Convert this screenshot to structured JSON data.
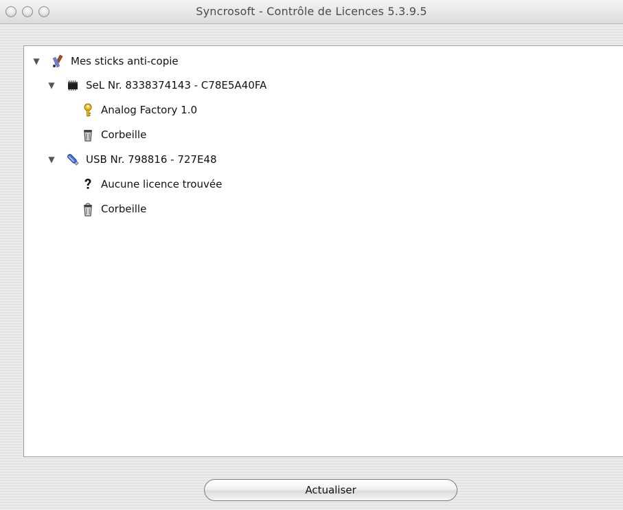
{
  "window": {
    "title": "Syncrosoft - Contrôle de Licences 5.3.9.5"
  },
  "tree": {
    "root": {
      "label": "Mes sticks anti-copie",
      "icon": "pen-pencil-icon",
      "expanded": true
    },
    "sticks": [
      {
        "label": "SeL Nr. 8338374143 - C78E5A40FA",
        "icon": "chip-icon",
        "expanded": true,
        "children": [
          {
            "label": "Analog Factory 1.0",
            "icon": "key-icon"
          },
          {
            "label": "Corbeille",
            "icon": "trash-icon"
          }
        ]
      },
      {
        "label": "USB Nr. 798816 - 727E48",
        "icon": "usb-stick-icon",
        "expanded": true,
        "children": [
          {
            "label": "Aucune licence trouvée",
            "icon": "question-icon"
          },
          {
            "label": "Corbeille",
            "icon": "trash-icon"
          }
        ]
      }
    ]
  },
  "buttons": {
    "refresh_label": "Actualiser"
  },
  "colors": {
    "key_yellow": "#e8c21a",
    "usb_blue": "#3d6fd6",
    "root_brown": "#9b4d1c"
  }
}
